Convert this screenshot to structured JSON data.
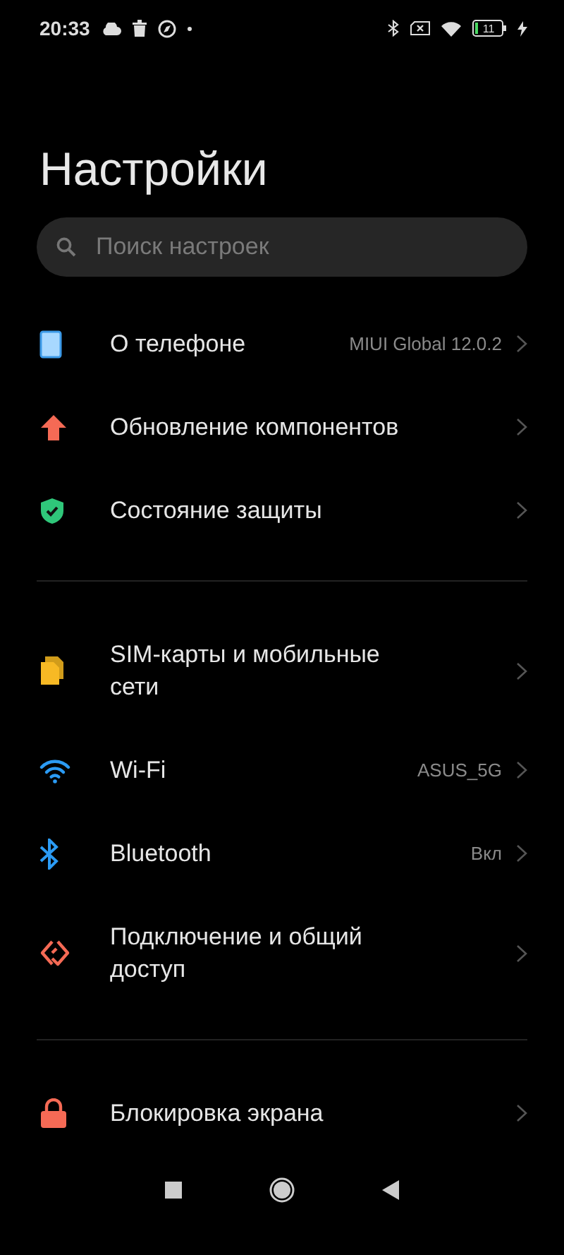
{
  "status_bar": {
    "time": "20:33",
    "battery": "11"
  },
  "title": "Настройки",
  "search": {
    "placeholder": "Поиск настроек"
  },
  "sections": [
    {
      "items": [
        {
          "kind": "phone",
          "label": "О телефоне",
          "value": "MIUI Global 12.0.2"
        },
        {
          "kind": "update",
          "label": "Обновление компонентов"
        },
        {
          "kind": "shield",
          "label": "Состояние защиты"
        }
      ]
    },
    {
      "items": [
        {
          "kind": "sim",
          "label": "SIM-карты и мобильные сети"
        },
        {
          "kind": "wifi",
          "label": "Wi-Fi",
          "value": "ASUS_5G"
        },
        {
          "kind": "bluetooth",
          "label": "Bluetooth",
          "value": "Вкл"
        },
        {
          "kind": "share",
          "label": "Подключение и общий доступ"
        }
      ]
    },
    {
      "items": [
        {
          "kind": "lock",
          "label": "Блокировка экрана"
        }
      ]
    }
  ]
}
